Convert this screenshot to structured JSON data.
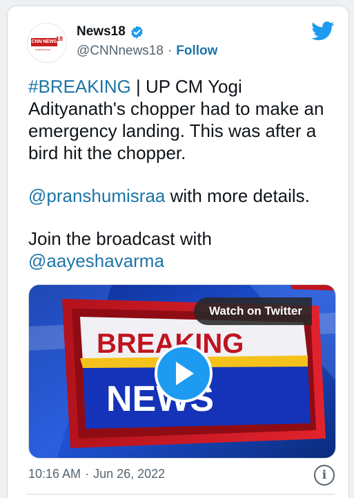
{
  "author": {
    "display_name": "News18",
    "handle": "@CNNnews18",
    "separator": "·",
    "follow_label": "Follow",
    "verified": true,
    "avatar_logo": {
      "cnn_label": "CNN NEWS",
      "number": "18",
      "site": "news18.com"
    }
  },
  "tweet": {
    "hashtag": "#BREAKING",
    "line1_rest": " | UP CM Yogi Adityanath's chopper had to make an emergency landing. This was after a bird hit the chopper.",
    "mention1": "@pranshumisraa",
    "line2_rest": " with more details.",
    "line3": "Join the broadcast with",
    "mention2": "@aayeshavarma"
  },
  "media": {
    "watch_label": "Watch on Twitter",
    "graphic_word1": "BREAKING",
    "graphic_word2": "NEWS"
  },
  "footer": {
    "time": "10:16 AM",
    "separator": "·",
    "date": "Jun 26, 2022",
    "info_label": "i"
  },
  "colors": {
    "link": "#1d75a8",
    "twitter_blue": "#1d9bf0",
    "muted": "#536471"
  }
}
